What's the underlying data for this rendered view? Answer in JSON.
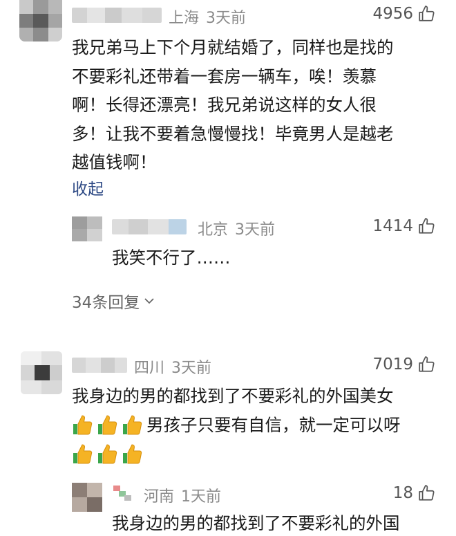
{
  "comments": [
    {
      "location": "上海",
      "time": "3天前",
      "likes": "4956",
      "lines": [
        "我兄弟马上下个月就结婚了，同样也是找的",
        "不要彩礼还带着一套房一辆车，唉！羡慕",
        "啊！长得还漂亮！我兄弟说这样的女人很",
        "多！让我不要着急慢慢找！毕竟男人是越老",
        "越值钱啊！"
      ],
      "collapse_label": "收起",
      "reply": {
        "location": "北京",
        "time": "3天前",
        "likes": "1414",
        "text": "我笑不行了……"
      },
      "replies_link": "34条回复"
    },
    {
      "location": "四川",
      "time": "3天前",
      "likes": "7019",
      "line1": "我身边的男的都找到了不要彩礼的外国美女",
      "line2_text": "男孩子只要有自信，就一定可以呀",
      "reply": {
        "location": "河南",
        "time": "1天前",
        "likes": "18",
        "text": "我身边的男的都找到了不要彩礼的外国"
      }
    }
  ],
  "icons": {
    "like": "thumbs-up-outline-icon",
    "emoji": "thumbs-up-emoji-icon",
    "chevron": "chevron-down-icon"
  },
  "colors": {
    "meta": "#8a8a8a",
    "link": "#2e4a85",
    "emoji": "#f5b324",
    "emoji_cuff": "#3aa64a"
  }
}
